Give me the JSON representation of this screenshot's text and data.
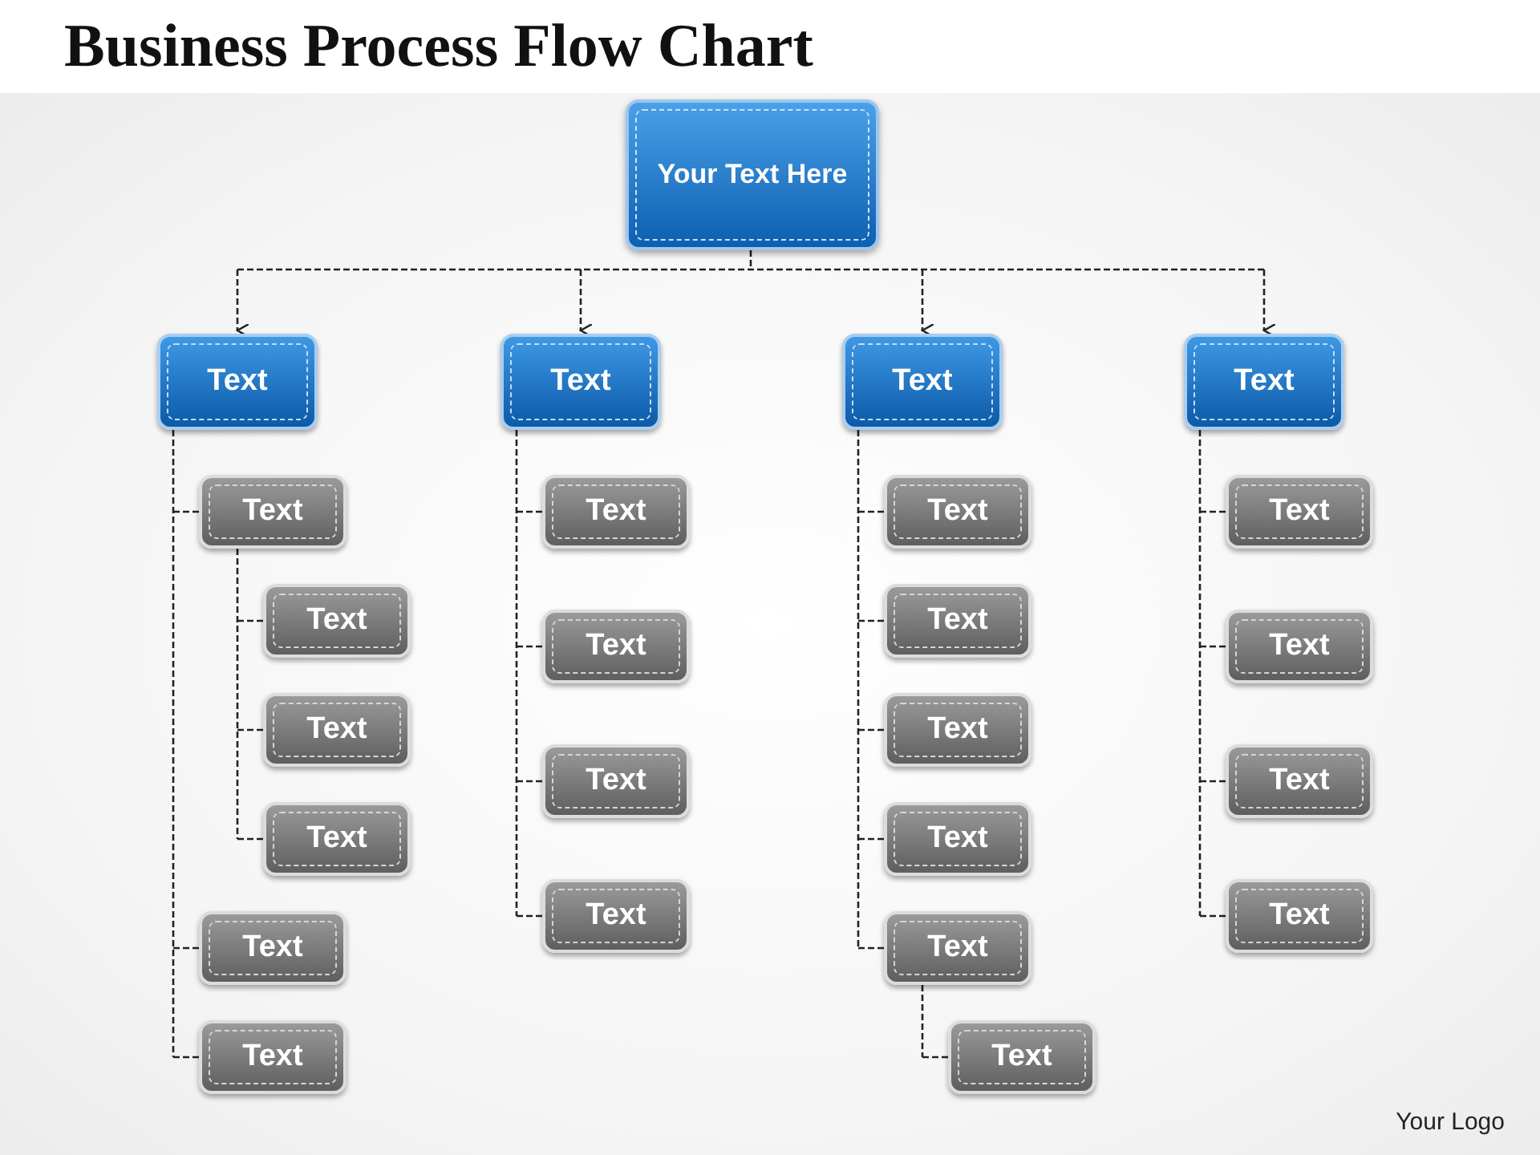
{
  "title": "Business Process Flow Chart",
  "root": {
    "label": "Your Text Here"
  },
  "branches": [
    {
      "label": "Text",
      "children": [
        {
          "label": "Text",
          "children": [
            {
              "label": "Text"
            },
            {
              "label": "Text"
            },
            {
              "label": "Text"
            }
          ]
        },
        {
          "label": "Text"
        },
        {
          "label": "Text"
        }
      ]
    },
    {
      "label": "Text",
      "children": [
        {
          "label": "Text"
        },
        {
          "label": "Text"
        },
        {
          "label": "Text"
        },
        {
          "label": "Text"
        }
      ]
    },
    {
      "label": "Text",
      "children": [
        {
          "label": "Text"
        },
        {
          "label": "Text"
        },
        {
          "label": "Text"
        },
        {
          "label": "Text"
        },
        {
          "label": "Text",
          "children": [
            {
              "label": "Text"
            }
          ]
        }
      ]
    },
    {
      "label": "Text",
      "children": [
        {
          "label": "Text"
        },
        {
          "label": "Text"
        },
        {
          "label": "Text"
        },
        {
          "label": "Text"
        }
      ]
    }
  ],
  "logo": "Your Logo"
}
